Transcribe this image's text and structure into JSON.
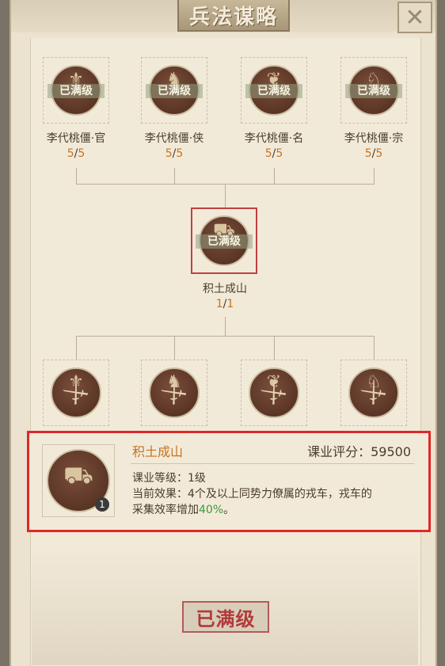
{
  "title": "兵法谋略",
  "close_icon": "close-icon",
  "tag_full": "已满级",
  "top_row": [
    {
      "label": "李代桃僵·官",
      "current": "5",
      "max": "5"
    },
    {
      "label": "李代桃僵·侠",
      "current": "5",
      "max": "5"
    },
    {
      "label": "李代桃僵·名",
      "current": "5",
      "max": "5"
    },
    {
      "label": "李代桃僵·宗",
      "current": "5",
      "max": "5"
    }
  ],
  "middle": {
    "label": "积土成山",
    "current": "1",
    "max": "1"
  },
  "detail": {
    "name": "积土成山",
    "score_label": "课业评分：",
    "score": "59500",
    "level_line": "课业等级：1级",
    "effect_line1": "当前效果：4个及以上同势力僚属的戎车，戎车的",
    "effect_line2_prefix": "采集效率增加",
    "effect_pct": "40%",
    "effect_line2_suffix": "。",
    "badge": "1"
  },
  "max_button": "已满级"
}
